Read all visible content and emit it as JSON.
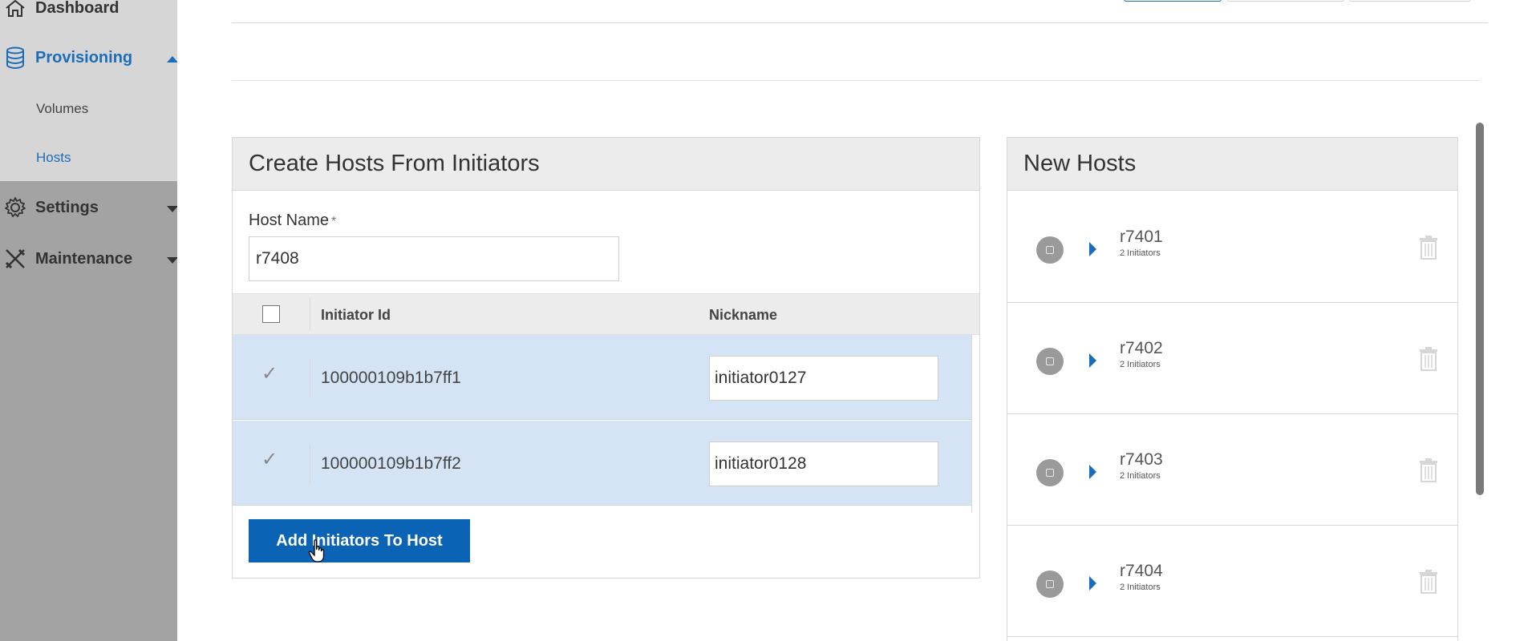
{
  "sidebar": {
    "items": [
      {
        "label": "Dashboard",
        "icon": "home-icon"
      },
      {
        "label": "Provisioning",
        "icon": "database-icon"
      },
      {
        "label": "Settings",
        "icon": "gear-icon"
      },
      {
        "label": "Maintenance",
        "icon": "tools-icon"
      }
    ],
    "sub_items": [
      {
        "label": "Volumes"
      },
      {
        "label": "Hosts"
      }
    ]
  },
  "create_panel": {
    "title": "Create Hosts From Initiators",
    "host_name_label": "Host Name",
    "required_mark": "*",
    "host_name_value": "r7408",
    "table": {
      "headers": [
        "Initiator Id",
        "Nickname"
      ],
      "rows": [
        {
          "initiator_id": "100000109b1b7ff1",
          "nickname": "initiator0127",
          "checked": true
        },
        {
          "initiator_id": "100000109b1b7ff2",
          "nickname": "initiator0128",
          "checked": true
        }
      ]
    },
    "add_button_label": "Add Initiators To Host"
  },
  "new_hosts_panel": {
    "title": "New Hosts",
    "hosts": [
      {
        "name": "r7401",
        "subtitle": "2 Initiators"
      },
      {
        "name": "r7402",
        "subtitle": "2 Initiators"
      },
      {
        "name": "r7403",
        "subtitle": "2 Initiators"
      },
      {
        "name": "r7404",
        "subtitle": "2 Initiators"
      }
    ]
  },
  "colors": {
    "accent": "#1c6db8",
    "button": "#0b63b5",
    "row_selected": "#d4e4f5",
    "sidebar_bg": "#a3a3a3"
  }
}
